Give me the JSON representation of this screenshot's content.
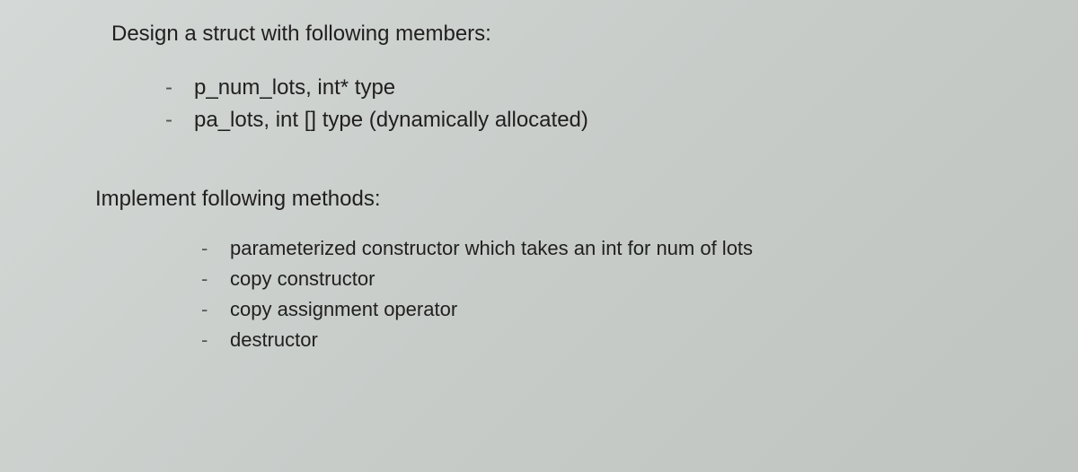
{
  "section1": {
    "heading": "Design a struct with following members:",
    "items": [
      "p_num_lots, int* type",
      "pa_lots, int [] type (dynamically allocated)"
    ]
  },
  "section2": {
    "heading": "Implement following methods:",
    "items": [
      "parameterized constructor which takes an int for num of lots",
      "copy constructor",
      "copy assignment operator",
      "destructor"
    ]
  },
  "bullet_char": "-"
}
